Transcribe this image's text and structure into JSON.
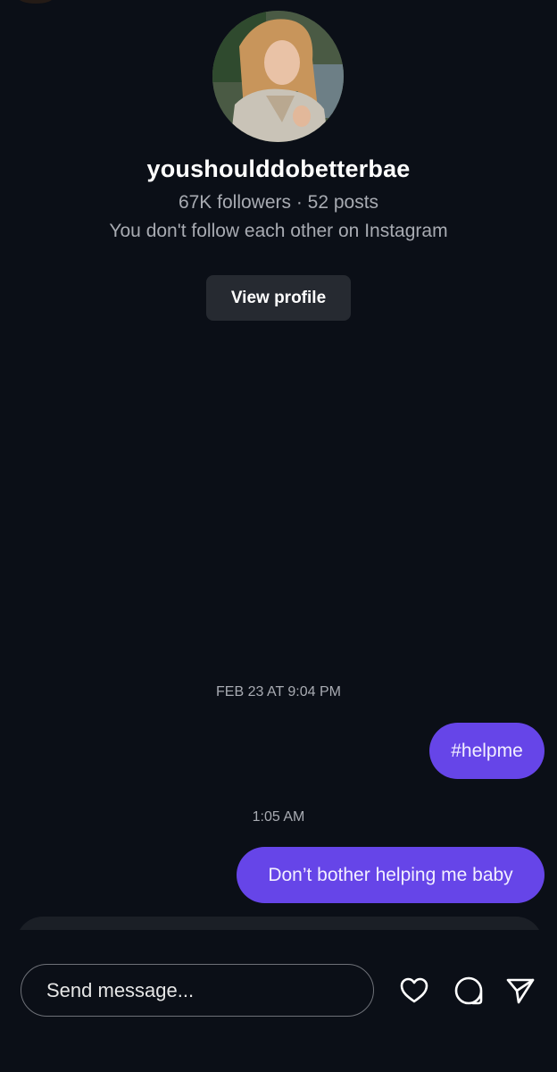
{
  "profile": {
    "username": "youshoulddobetterbae",
    "stats": "67K followers · 52 posts",
    "follow_status": "You don't follow each other on Instagram",
    "view_profile_label": "View profile"
  },
  "conversation": {
    "timestamps": [
      "FEB 23 AT 9:04 PM",
      "1:05 AM"
    ],
    "messages": [
      {
        "text": "#helpme",
        "sender": "me"
      },
      {
        "text": "Don’t bother helping me baby",
        "sender": "me"
      }
    ]
  },
  "composer": {
    "placeholder": "Send message...",
    "icons": [
      "heart-icon",
      "sticker-icon",
      "send-icon"
    ]
  },
  "colors": {
    "background": "#0b0f17",
    "bubble": "#6645e8",
    "button": "#262a31",
    "secondary_text": "#a8abb2"
  }
}
